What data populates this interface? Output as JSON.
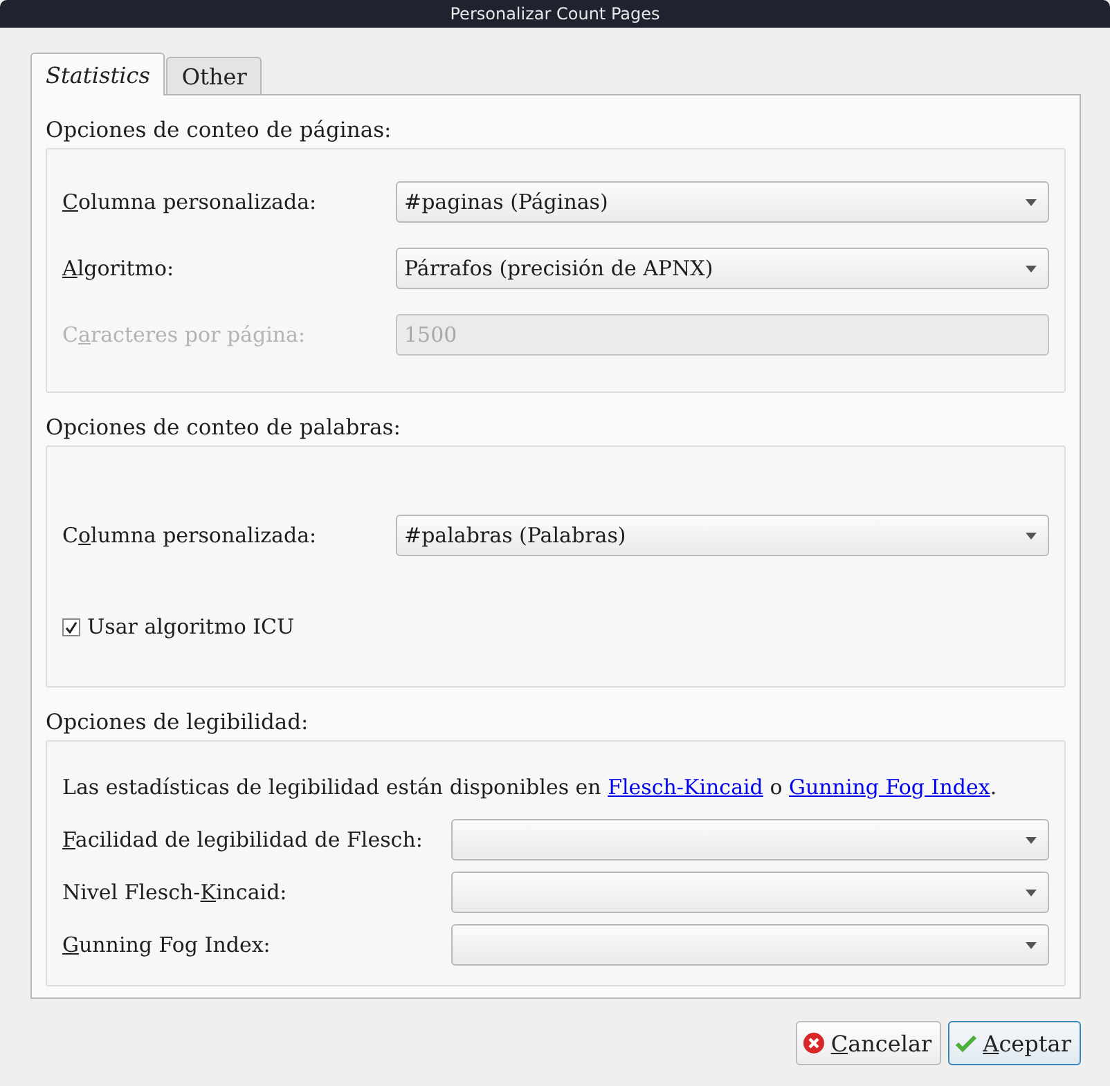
{
  "window": {
    "title": "Personalizar Count Pages"
  },
  "tabs": [
    {
      "label": "Statistics",
      "selected": true
    },
    {
      "label": "Other",
      "selected": false
    }
  ],
  "page_count": {
    "heading": "Opciones de conteo de páginas:",
    "rows": [
      {
        "kind": "combo",
        "label": {
          "accel": "C",
          "after": "olumna personalizada:"
        },
        "value": "#paginas (Páginas)",
        "disabled": false
      },
      {
        "kind": "combo",
        "label": {
          "accel": "A",
          "after": "lgoritmo:"
        },
        "value": "Párrafos (precisión de APNX)",
        "disabled": false
      },
      {
        "kind": "field",
        "label": {
          "before": "C",
          "accel": "a",
          "after": "racteres por página:"
        },
        "value": "1500",
        "disabled": true
      }
    ]
  },
  "word_count": {
    "heading": "Opciones de conteo de palabras:",
    "rows": [
      {
        "kind": "combo",
        "label": {
          "before": "C",
          "accel": "o",
          "after": "lumna personalizada:"
        },
        "value": "#palabras (Palabras)",
        "disabled": false
      },
      {
        "kind": "checkbox",
        "label": {
          "after": "Usar algoritmo ICU"
        },
        "checked": true
      }
    ]
  },
  "readability": {
    "heading": "Opciones de legibilidad:",
    "note": [
      {
        "kind": "text",
        "text": "Las estadísticas de legibilidad están disponibles en "
      },
      {
        "kind": "link",
        "text": "Flesch-Kincaid"
      },
      {
        "kind": "text",
        "text": " o "
      },
      {
        "kind": "link",
        "text": "Gunning Fog Index"
      },
      {
        "kind": "text",
        "text": "."
      }
    ],
    "rows": [
      {
        "kind": "combo",
        "label": {
          "accel": "F",
          "after": "acilidad de legibilidad de Flesch:"
        },
        "disabled": false
      },
      {
        "kind": "combo",
        "label": {
          "before": "Nivel Flesch-",
          "accel": "K",
          "after": "incaid:"
        },
        "disabled": false
      },
      {
        "kind": "combo",
        "label": {
          "accel": "G",
          "after": "unning Fog Index:"
        },
        "disabled": false
      }
    ]
  },
  "buttons": [
    {
      "kind": "cancel",
      "label": {
        "accel": "C",
        "after": "ancelar"
      },
      "default": false
    },
    {
      "kind": "ok",
      "label": {
        "accel": "A",
        "after": "ceptar"
      },
      "default": true
    }
  ]
}
